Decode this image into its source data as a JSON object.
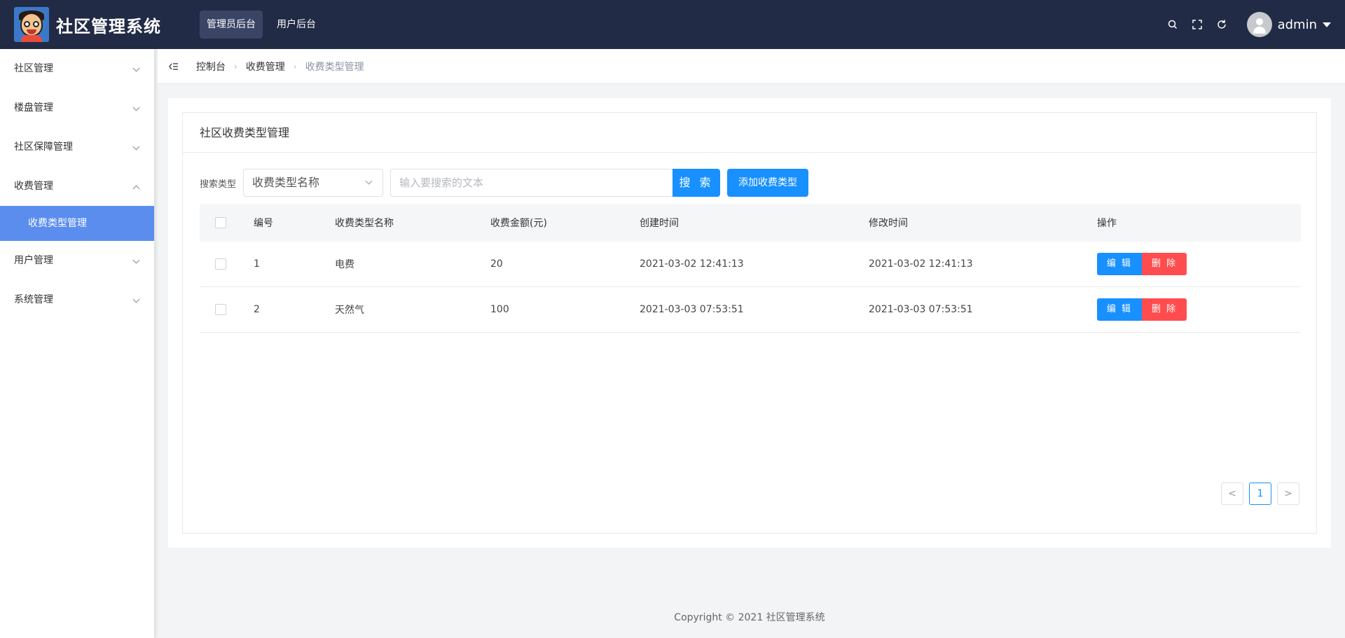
{
  "header": {
    "brand": "社区管理系统",
    "nav": [
      {
        "label": "管理员后台",
        "active": true
      },
      {
        "label": "用户后台",
        "active": false
      }
    ],
    "username": "admin",
    "icons": [
      "search-icon",
      "fullscreen-icon",
      "refresh-icon",
      "avatar",
      "caret-down-icon"
    ],
    "bg_color": "#222b45"
  },
  "sidebar": {
    "items": [
      {
        "label": "社区管理",
        "expanded": false
      },
      {
        "label": "楼盘管理",
        "expanded": false
      },
      {
        "label": "社区保障管理",
        "expanded": false
      },
      {
        "label": "收费管理",
        "expanded": true,
        "children": [
          {
            "label": "收费类型管理",
            "active": true
          }
        ]
      },
      {
        "label": "用户管理",
        "expanded": false
      },
      {
        "label": "系统管理",
        "expanded": false
      }
    ],
    "active_color": "#5b8def"
  },
  "breadcrumb": [
    "控制台",
    "收费管理",
    "收费类型管理"
  ],
  "card": {
    "title": "社区收费类型管理"
  },
  "search": {
    "label": "搜索类型",
    "select_value": "收费类型名称",
    "input_placeholder": "输入要搜索的文本",
    "search_button": "搜 索",
    "add_button": "添加收费类型"
  },
  "table": {
    "columns": [
      "编号",
      "收费类型名称",
      "收费金额(元)",
      "创建时间",
      "修改时间",
      "操作"
    ],
    "rows": [
      {
        "id": "1",
        "name": "电费",
        "amount": "20",
        "created": "2021-03-02 12:41:13",
        "modified": "2021-03-02 12:41:13"
      },
      {
        "id": "2",
        "name": "天然气",
        "amount": "100",
        "created": "2021-03-03 07:53:51",
        "modified": "2021-03-03 07:53:51"
      }
    ],
    "edit_label": "编 辑",
    "delete_label": "删 除"
  },
  "pagination": {
    "prev": "<",
    "current": "1",
    "next": ">"
  },
  "footer": "Copyright © 2021 社区管理系统",
  "colors": {
    "primary": "#1890ff",
    "danger": "#ff4d4f"
  }
}
